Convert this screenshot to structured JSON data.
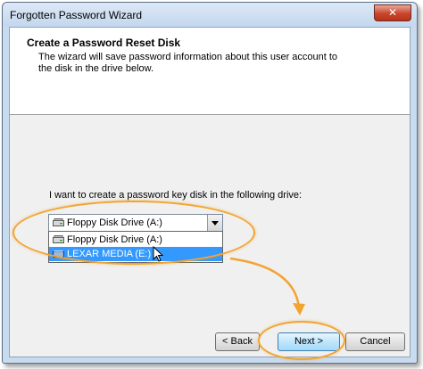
{
  "window": {
    "title": "Forgotten Password Wizard",
    "close_glyph": "✕"
  },
  "header": {
    "title": "Create a Password Reset Disk",
    "description": "The wizard will save password information about this user account to the disk in the drive below."
  },
  "body": {
    "prompt": "I want to create a password key disk in the following drive:"
  },
  "drive_combo": {
    "selected": "Floppy Disk Drive (A:)",
    "icon": "drive-icon",
    "options": [
      {
        "label": "Floppy Disk Drive (A:)",
        "highlighted": false
      },
      {
        "label": "LEXAR MEDIA (E:)",
        "highlighted": true
      }
    ]
  },
  "buttons": {
    "back": "< Back",
    "next": "Next >",
    "cancel": "Cancel"
  },
  "colors": {
    "highlight": "#3399ff",
    "annotation": "#f2a431"
  }
}
